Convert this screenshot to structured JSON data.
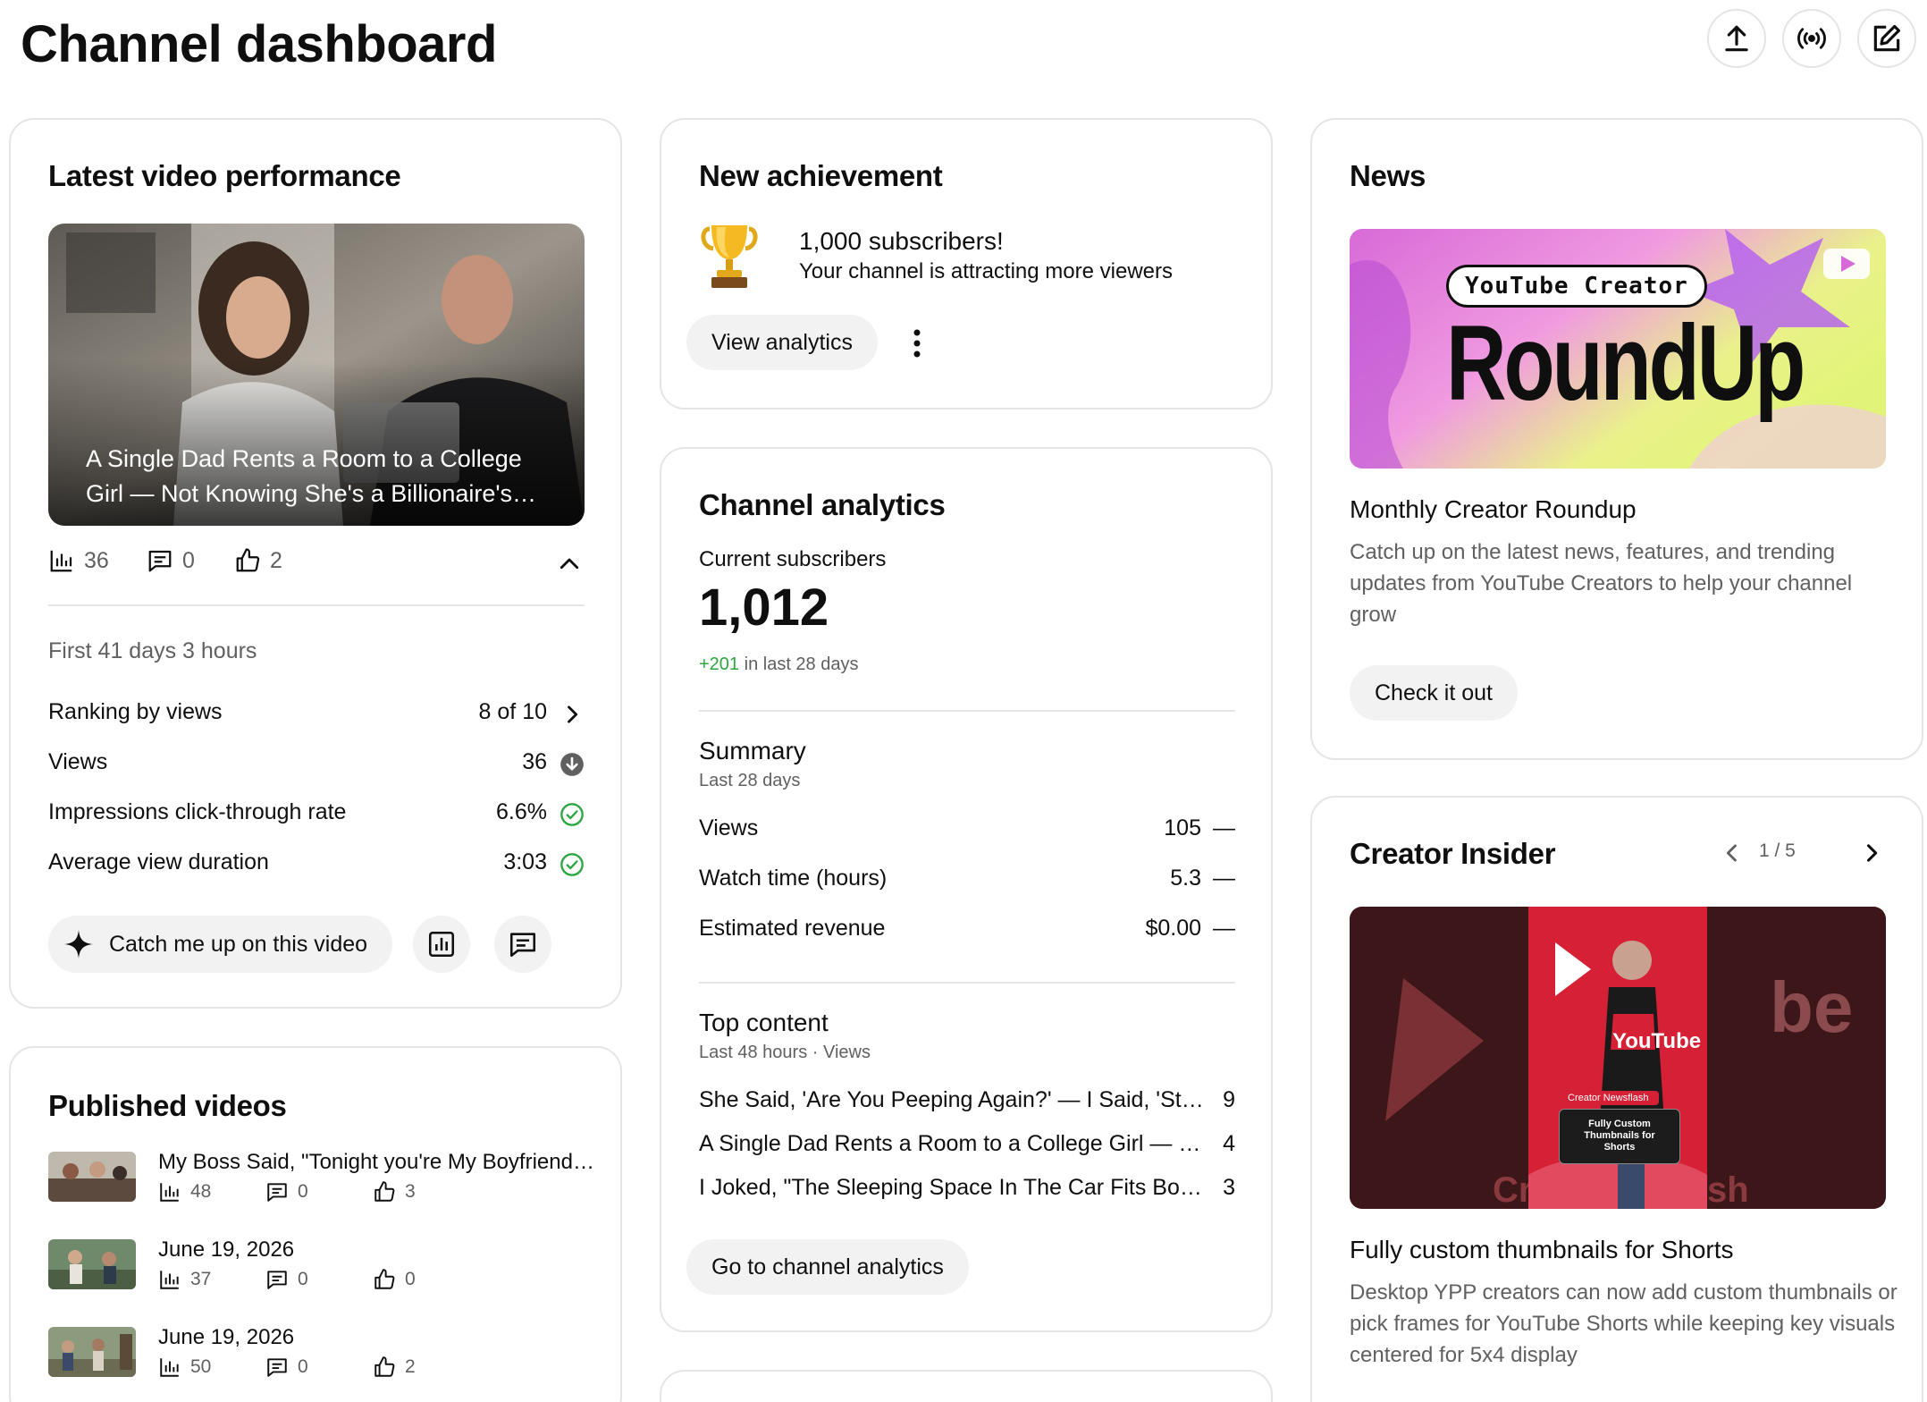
{
  "header": {
    "title": "Channel dashboard",
    "actions": [
      "upload-icon",
      "live-icon",
      "create-post-icon"
    ]
  },
  "latest_video": {
    "heading": "Latest video performance",
    "thumbnail_title": "A Single Dad Rents a Room to a College Girl — Not Knowing She's a Billionaire's…",
    "stats": {
      "views": "36",
      "comments": "0",
      "likes": "2"
    },
    "period": "First 41 days 3 hours",
    "metrics": [
      {
        "label": "Ranking by views",
        "value": "8 of 10",
        "icon": "chevron-right-icon"
      },
      {
        "label": "Views",
        "value": "36",
        "icon": "down-arrow-icon"
      },
      {
        "label": "Impressions click-through rate",
        "value": "6.6%",
        "icon": "check-circle-icon"
      },
      {
        "label": "Average view duration",
        "value": "3:03",
        "icon": "check-circle-icon"
      }
    ],
    "catch_up_label": "Catch me up on this video"
  },
  "published": {
    "heading": "Published videos",
    "items": [
      {
        "title": "My Boss Said, \"Tonight you're My Boyfriend…",
        "views": "48",
        "comments": "0",
        "likes": "3"
      },
      {
        "title": "June 19, 2026",
        "views": "37",
        "comments": "0",
        "likes": "0"
      },
      {
        "title": "June 19, 2026",
        "views": "50",
        "comments": "0",
        "likes": "2"
      }
    ]
  },
  "achievement": {
    "heading": "New achievement",
    "title": "1,000 subscribers!",
    "subtitle": "Your channel is attracting more viewers",
    "button": "View analytics"
  },
  "analytics": {
    "heading": "Channel analytics",
    "subs_label": "Current subscribers",
    "subs_value": "1,012",
    "subs_change": "+201",
    "subs_change_suffix": "in last 28 days",
    "summary_heading": "Summary",
    "summary_period": "Last 28 days",
    "summary": [
      {
        "label": "Views",
        "value": "105",
        "trend": "—"
      },
      {
        "label": "Watch time (hours)",
        "value": "5.3",
        "trend": "—"
      },
      {
        "label": "Estimated revenue",
        "value": "$0.00",
        "trend": "—"
      }
    ],
    "top_heading": "Top content",
    "top_period": "Last 48 hours · Views",
    "top": [
      {
        "title": "She Said, 'Are You Peeping Again?' — I Said, 'Stop S…",
        "views": "9"
      },
      {
        "title": "A Single Dad Rents a Room to a College Girl — Not …",
        "views": "4"
      },
      {
        "title": "I Joked, \"The Sleeping Space In The Car Fits Both O…",
        "views": "3"
      }
    ],
    "button": "Go to channel analytics"
  },
  "news": {
    "heading": "News",
    "banner_tag": "YouTube Creator",
    "banner_word": "RoundUp",
    "title": "Monthly Creator Roundup",
    "body": "Catch up on the latest news, features, and trending updates from YouTube Creators to help your channel grow",
    "button": "Check it out"
  },
  "insider": {
    "heading": "Creator Insider",
    "pager": "1 / 5",
    "video_badge": "Creator Newsflash",
    "video_card": "Fully Custom Thumbnails for Shorts",
    "title": "Fully custom thumbnails for Shorts",
    "body": "Desktop YPP creators can now add custom thumbnails or pick frames for YouTube Shorts while keeping key visuals centered for 5x4 display"
  },
  "colors": {
    "positive": "#2ba640",
    "muted": "#606060",
    "pill": "#f2f2f2",
    "border": "#e5e5e5"
  }
}
